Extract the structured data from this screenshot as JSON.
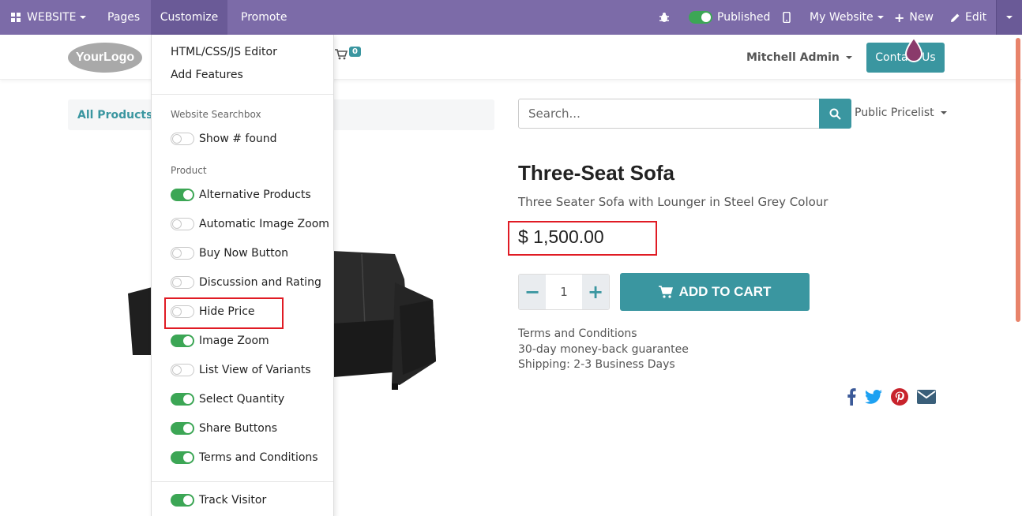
{
  "topbar": {
    "website": "WEBSITE",
    "pages": "Pages",
    "customize": "Customize",
    "promote": "Promote",
    "published": "Published",
    "my_website": "My Website",
    "new": "New",
    "edit": "Edit"
  },
  "header": {
    "logo": "YourLogo",
    "cart_count": "0",
    "user": "Mitchell Admin",
    "contact": "Contact Us"
  },
  "breadcrumb": {
    "all_products": "All Products"
  },
  "search": {
    "placeholder": "Search..."
  },
  "pricelist": "Public Pricelist",
  "product": {
    "title": "Three-Seat Sofa",
    "subtitle": "Three Seater Sofa with Lounger in Steel Grey Colour",
    "price": "$ 1,500.00",
    "quantity": "1",
    "add_to_cart": "ADD TO CART",
    "terms": [
      "Terms and Conditions",
      "30-day money-back guarantee",
      "Shipping: 2-3 Business Days"
    ]
  },
  "menu": {
    "editor": "HTML/CSS/JS Editor",
    "add_features": "Add Features",
    "section_searchbox": "Website Searchbox",
    "show_found": "Show # found",
    "section_product": "Product",
    "options": [
      {
        "label": "Alternative Products",
        "on": true
      },
      {
        "label": "Automatic Image Zoom",
        "on": false
      },
      {
        "label": "Buy Now Button",
        "on": false
      },
      {
        "label": "Discussion and Rating",
        "on": false
      },
      {
        "label": "Hide Price",
        "on": false
      },
      {
        "label": "Image Zoom",
        "on": true
      },
      {
        "label": "List View of Variants",
        "on": false
      },
      {
        "label": "Select Quantity",
        "on": true
      },
      {
        "label": "Share Buttons",
        "on": true
      },
      {
        "label": "Terms and Conditions",
        "on": true
      }
    ],
    "track_visitor": "Track Visitor"
  },
  "colors": {
    "topbar": "#7c6ba8",
    "accent": "#3a96a0",
    "toggle_on": "#3ca655",
    "highlight": "#e01b24"
  }
}
